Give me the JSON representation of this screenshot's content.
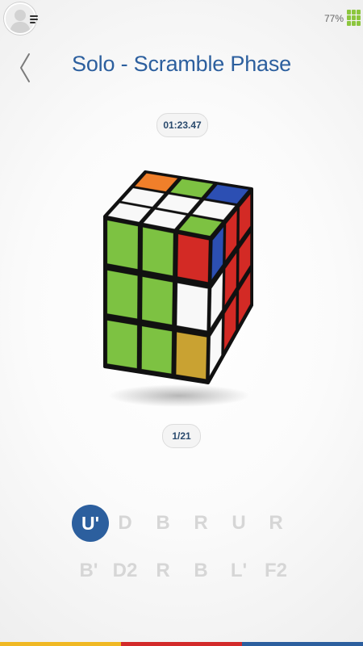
{
  "status_bar": {
    "battery_percent": "77%",
    "battery_color": "#8cc63e"
  },
  "header": {
    "title": "Solo - Scramble Phase"
  },
  "timer": {
    "value": "01:23.47"
  },
  "progress": {
    "label": "1/21",
    "current": 1,
    "total": 21
  },
  "cube": {
    "top_face": [
      [
        "orange",
        "green",
        "blue"
      ],
      [
        "white",
        "white",
        "white"
      ],
      [
        "white",
        "white",
        "green"
      ]
    ],
    "front_face": [
      [
        "green",
        "green",
        "red"
      ],
      [
        "green",
        "green",
        "white"
      ],
      [
        "green",
        "green",
        "yellow"
      ]
    ],
    "right_face": [
      [
        "blue",
        "red",
        "red"
      ],
      [
        "white",
        "red",
        "red"
      ],
      [
        "white",
        "red",
        "red"
      ]
    ],
    "colors": {
      "white": "#f8f8f8",
      "green": "#7dc242",
      "red": "#d32a25",
      "blue": "#2c4fb3",
      "orange": "#f07f2a",
      "yellow": "#c9a232"
    }
  },
  "scramble": {
    "active_index": 0,
    "row1": [
      "U'",
      "D",
      "B",
      "R",
      "U",
      "R"
    ],
    "row2": [
      "B'",
      "D2",
      "R",
      "B",
      "L'",
      "F2"
    ]
  },
  "accent_colors": {
    "primary_blue": "#2c5f9e",
    "strip": [
      "#f0b823",
      "#d32a2a",
      "#2c5f9e"
    ]
  }
}
